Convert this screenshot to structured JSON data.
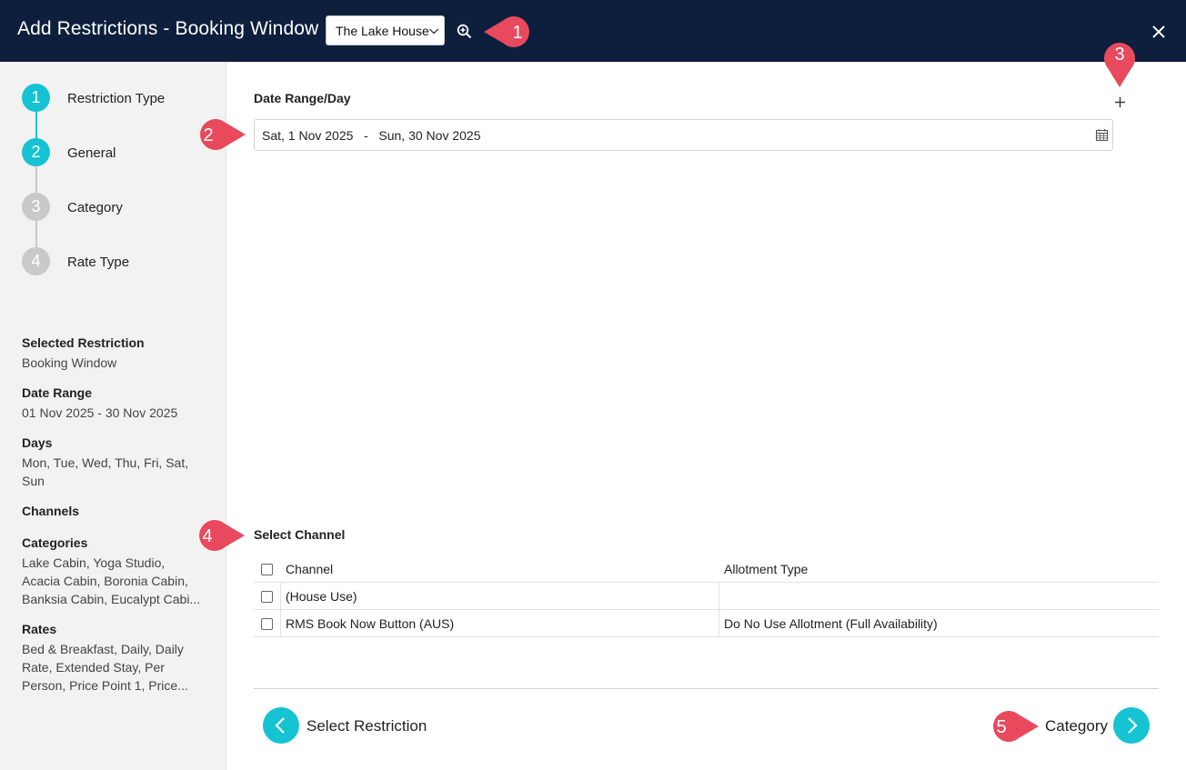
{
  "header": {
    "title": "Add Restrictions - Booking Window",
    "property_select": "The Lake House"
  },
  "steps": [
    {
      "number": "1",
      "label": "Restriction Type",
      "state": "complete"
    },
    {
      "number": "2",
      "label": "General",
      "state": "active"
    },
    {
      "number": "3",
      "label": "Category",
      "state": "pending"
    },
    {
      "number": "4",
      "label": "Rate Type",
      "state": "pending"
    }
  ],
  "summary": {
    "selected_restriction": {
      "heading": "Selected Restriction",
      "value": "Booking Window"
    },
    "date_range": {
      "heading": "Date Range",
      "value": "01 Nov 2025 - 30 Nov 2025"
    },
    "days": {
      "heading": "Days",
      "value_line1": "Mon, Tue, Wed, Thu, Fri, Sat,",
      "value_line2": "Sun"
    },
    "channels": {
      "heading": "Channels"
    },
    "categories": {
      "heading": "Categories",
      "value_line1": "Lake Cabin, Yoga Studio,",
      "value_line2": "Acacia Cabin, Boronia Cabin,",
      "value_line3": "Banksia Cabin, Eucalypt Cabi..."
    },
    "rates": {
      "heading": "Rates",
      "value_line1": "Bed & Breakfast, Daily, Daily",
      "value_line2": "Rate, Extended Stay, Per",
      "value_line3": "Person, Price Point 1, Price..."
    }
  },
  "main": {
    "date_section_title": "Date Range/Day",
    "date_range_value": "Sat, 1 Nov 2025   -   Sun, 30 Nov 2025",
    "channel_section_title": "Select Channel",
    "table": {
      "headers": {
        "channel": "Channel",
        "allotment": "Allotment Type"
      },
      "rows": [
        {
          "channel": "(House Use)",
          "allotment": ""
        },
        {
          "channel": "RMS Book Now Button (AUS)",
          "allotment": "Do No Use Allotment (Full Availability)"
        }
      ]
    },
    "back_label": "Select Restriction",
    "next_label": "Category"
  },
  "callouts": [
    "1",
    "2",
    "3",
    "4",
    "5"
  ],
  "colors": {
    "header_bg": "#0d1f3c",
    "accent": "#15c3d2",
    "callout": "#e8495d",
    "sidebar_bg": "#f2f2f2"
  }
}
